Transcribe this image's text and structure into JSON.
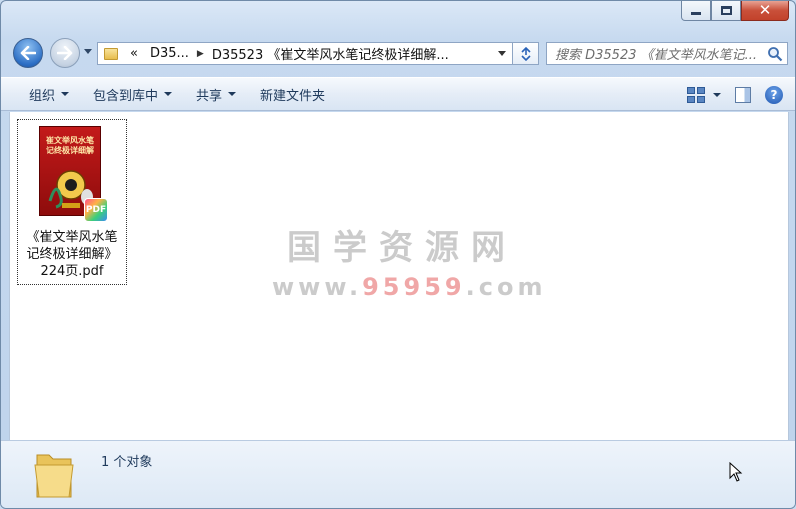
{
  "window": {
    "address": {
      "crumbs": [
        "«",
        "D35...",
        "D35523 《崔文举风水笔记终极详细解..."
      ]
    },
    "search_placeholder": "搜索 D35523 《崔文举风水笔记...",
    "caption": {
      "minimize": "–",
      "maximize": "□",
      "close": "✕"
    }
  },
  "toolbar": {
    "organize": "组织",
    "include_library": "包含到库中",
    "share": "共享",
    "new_folder": "新建文件夹"
  },
  "content": {
    "files": [
      {
        "name_line1": "《崔文举风水笔",
        "name_line2": "记终极详细解》",
        "name_line3": "224页.pdf",
        "thumb_title_line1": "崔文举风水笔",
        "thumb_title_line2": "记终极详细解",
        "badge": "PDF"
      }
    ],
    "watermark": {
      "cn": "国学资源网",
      "url_pre": "www.",
      "url_hl": "95959",
      "url_post": ".com"
    }
  },
  "status": {
    "text": "1 个对象"
  },
  "colors": {
    "accent": "#1e395b",
    "close": "#c9503a",
    "thumb": "#c31a1a"
  }
}
